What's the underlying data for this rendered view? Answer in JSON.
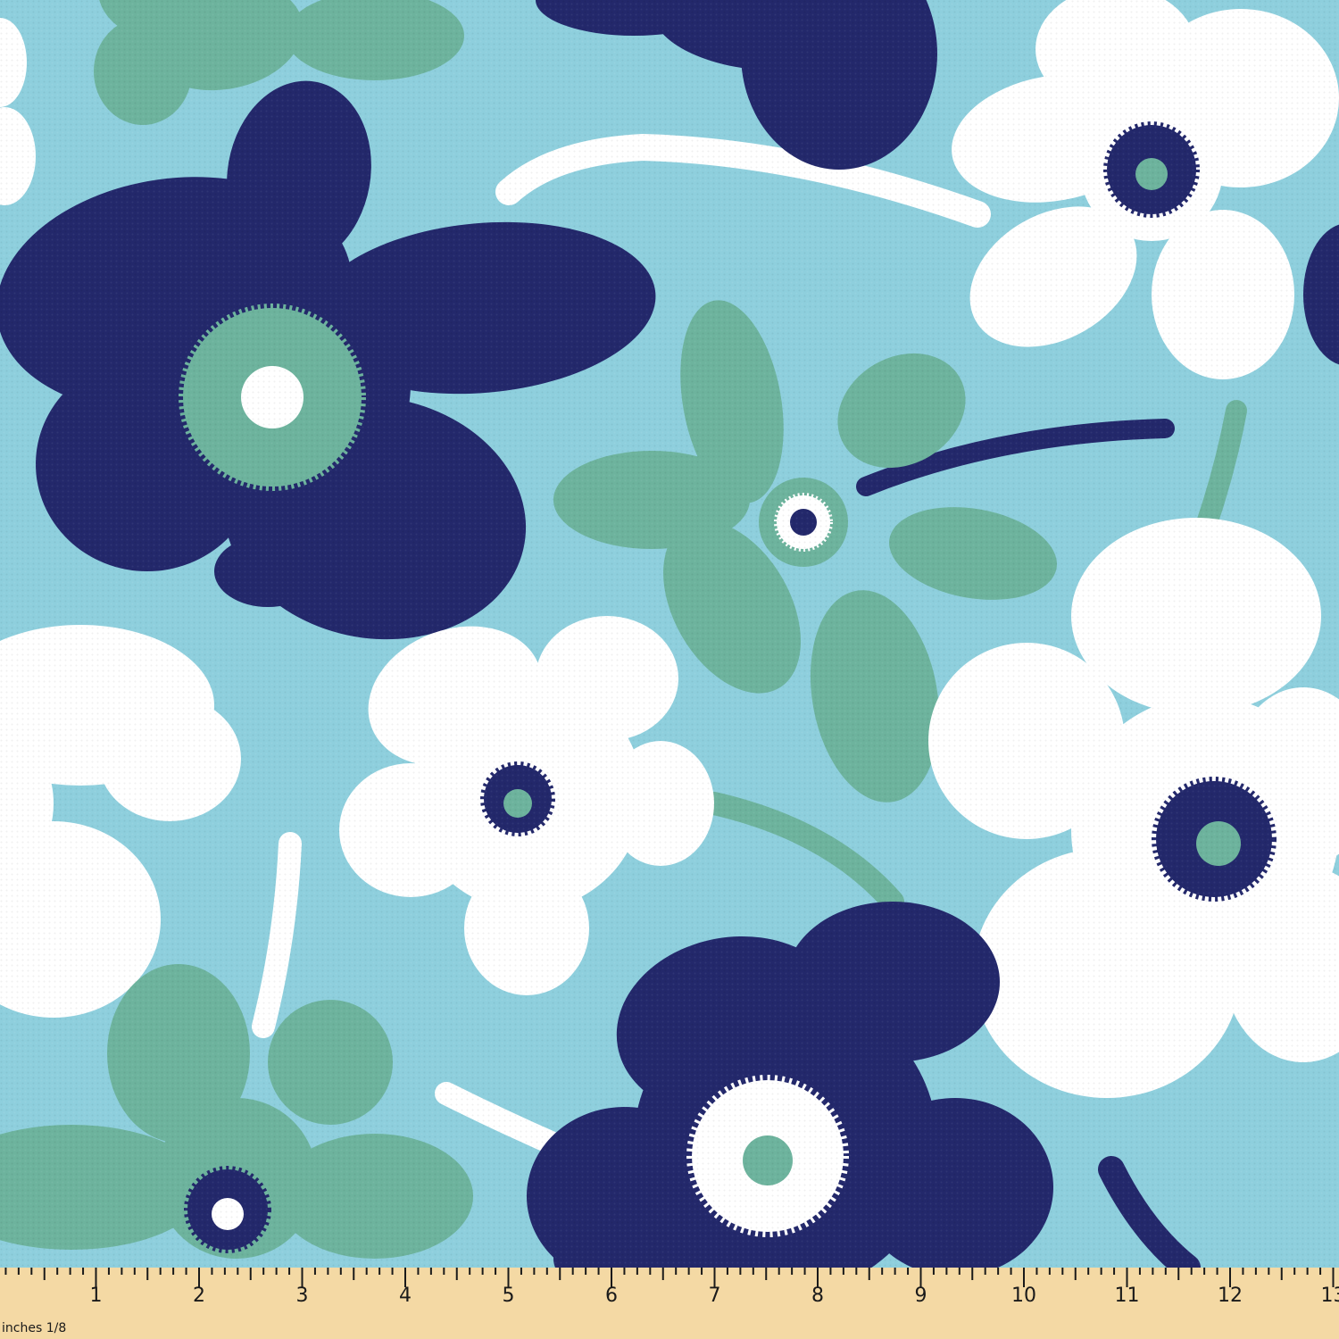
{
  "colors": {
    "background": "#8ecfdd",
    "navy": "#23286b",
    "mint": "#6db39d",
    "white": "#ffffff",
    "ruler": "#f4d9a4",
    "ruler_ink": "#1a1a1a"
  },
  "ruler": {
    "unit_label": "inches 1/8",
    "numbers": [
      "1",
      "2",
      "3",
      "4",
      "5",
      "6",
      "7",
      "8",
      "9",
      "10",
      "11",
      "12",
      "13"
    ]
  }
}
